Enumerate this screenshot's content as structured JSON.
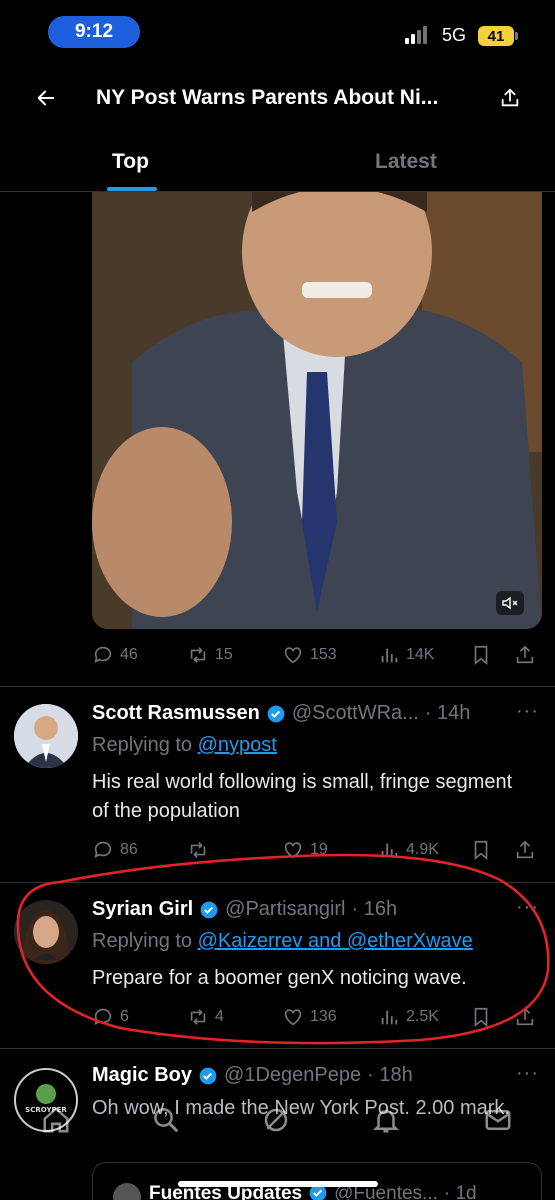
{
  "status_bar": {
    "time": "9:12",
    "network": "5G",
    "battery": "41"
  },
  "header": {
    "title": "NY Post Warns Parents About Ni..."
  },
  "tabs": [
    {
      "label": "Top"
    },
    {
      "label": "Latest"
    }
  ],
  "icons": {
    "back": "arrow-left-icon",
    "share": "share-icon",
    "reply": "reply-icon",
    "retweet": "retweet-icon",
    "like": "heart-icon",
    "views": "views-icon",
    "bookmark": "bookmark-icon",
    "mute": "mute-icon",
    "verified": "verified-badge-icon",
    "more": "more-icon"
  },
  "colors": {
    "accent": "#1d9bf0",
    "muted": "#71767b",
    "annotation": "#e0242a",
    "battery": "#f4d13a"
  },
  "video_post": {
    "replies": "46",
    "retweets": "15",
    "likes": "153",
    "views": "14K"
  },
  "tweets": [
    {
      "name": "Scott Rasmussen",
      "handle": "@ScottWRa...",
      "time": "· 14h",
      "replying_label": "Replying to",
      "replying_to": "@nypost",
      "text": "His real world following is small, fringe segment of the population",
      "replies": "86",
      "retweets": "",
      "likes": "19",
      "views": "4.9K"
    },
    {
      "name": "Syrian Girl",
      "handle": "@Partisangirl",
      "time": "· 16h",
      "replying_label": "Replying to",
      "replying_to": "@Kaizerrev and @etherXwave",
      "text": "Prepare for a boomer genX  noticing wave.",
      "replies": "6",
      "retweets": "4",
      "likes": "136",
      "views": "2.5K"
    },
    {
      "name": "Magic Boy",
      "handle": "@1DegenPepe",
      "time": "· 18h",
      "avatar_text": "SCROYPER",
      "text": "Oh wow, I made the New York Post. 2.00 mark."
    }
  ],
  "quoted": {
    "name": "Fuentes Updates",
    "handle": "@Fuentes...",
    "time": "· 1d"
  },
  "more_label": "···"
}
